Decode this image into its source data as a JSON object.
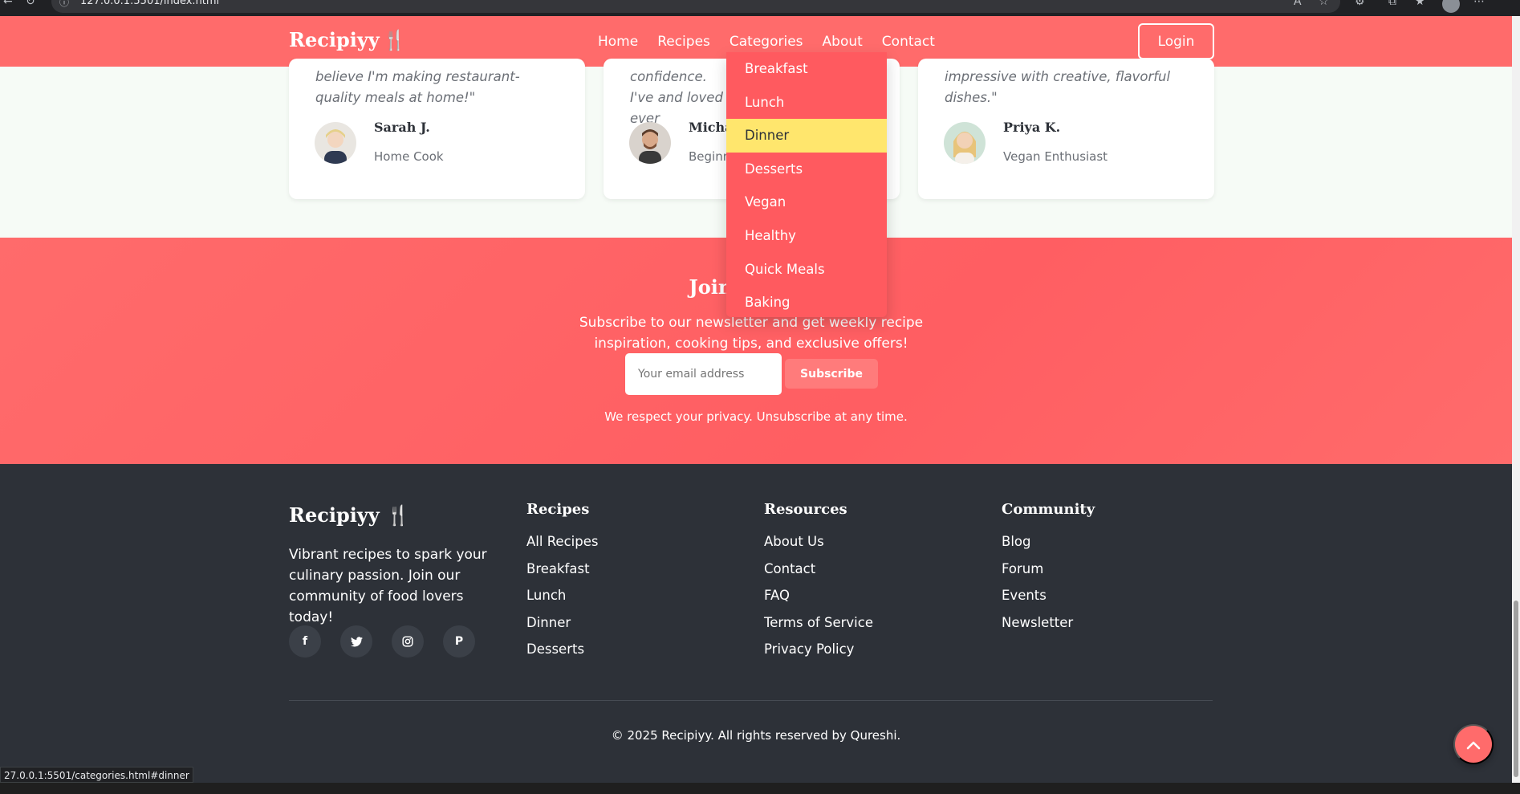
{
  "browser": {
    "url": "127.0.0.1:5501/index.html"
  },
  "navbar": {
    "brand": "Recipiyy",
    "links": [
      "Home",
      "Recipes",
      "Categories",
      "About",
      "Contact"
    ],
    "login_label": "Login"
  },
  "categories_dropdown": {
    "items": [
      "Breakfast",
      "Lunch",
      "Dinner",
      "Desserts",
      "Vegan",
      "Healthy",
      "Quick Meals",
      "Baking"
    ],
    "hovered": "Dinner"
  },
  "testimonials": [
    {
      "quote": "believe I'm making restaurant-quality meals at home!\"",
      "name": "Sarah J.",
      "role": "Home Cook"
    },
    {
      "quote": "confidence. I've and loved ever",
      "name": "Micha",
      "role": "Beginn"
    },
    {
      "quote": "impressive with creative, flavorful dishes.\"",
      "name": "Priya K.",
      "role": "Vegan Enthusiast"
    }
  ],
  "newsletter": {
    "title": "Join Our Cul",
    "text": "Subscribe to our newsletter and get weekly recipe inspiration, cooking tips, and exclusive offers!",
    "email_placeholder": "Your email address",
    "button_label": "Subscribe",
    "privacy": "We respect your privacy. Unsubscribe at any time."
  },
  "footer": {
    "brand": "Recipiyy",
    "description": "Vibrant recipes to spark your culinary passion. Join our community of food lovers today!",
    "socials": [
      "facebook-icon",
      "twitter-icon",
      "instagram-icon",
      "pinterest-icon"
    ],
    "columns": [
      {
        "title": "Recipes",
        "links": [
          "All Recipes",
          "Breakfast",
          "Lunch",
          "Dinner",
          "Desserts"
        ]
      },
      {
        "title": "Resources",
        "links": [
          "About Us",
          "Contact",
          "FAQ",
          "Terms of Service",
          "Privacy Policy"
        ]
      },
      {
        "title": "Community",
        "links": [
          "Blog",
          "Forum",
          "Events",
          "Newsletter"
        ]
      }
    ],
    "copyright": "© 2025 Recipiyy. All rights reserved by Qureshi."
  },
  "status_bar": {
    "link_preview": "27.0.0.1:5501/categories.html#dinner"
  },
  "colors": {
    "primary": "#ff6b6b",
    "accent": "#4ecdc4",
    "highlight": "#ffe66d",
    "dark": "#2d3138"
  }
}
